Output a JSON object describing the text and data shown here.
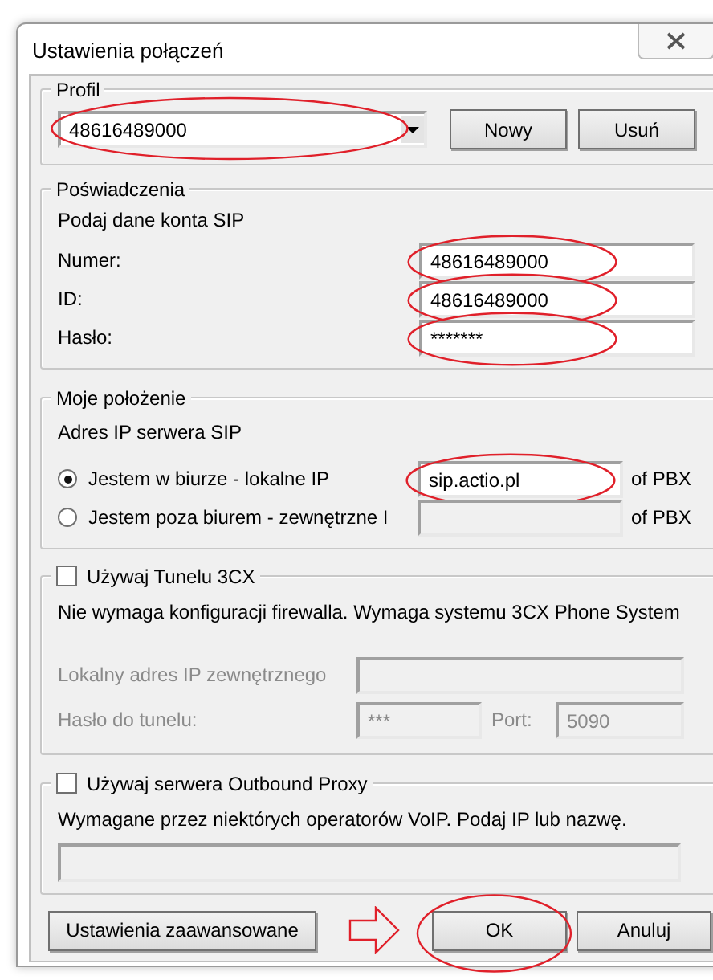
{
  "window": {
    "title": "Ustawienia połączeń"
  },
  "profile": {
    "legend": "Profil",
    "value": "48616489000",
    "marked": true,
    "buttons": [
      {
        "label": "Nowy"
      },
      {
        "label": "Usuń"
      }
    ]
  },
  "credentials": {
    "legend": "Poświadczenia",
    "hint": "Podaj dane konta SIP",
    "fields": [
      {
        "label": "Numer:",
        "value": "48616489000",
        "marked": true
      },
      {
        "label": "ID:",
        "value": "48616489000",
        "marked": true
      },
      {
        "label": "Hasło:",
        "value": "*******",
        "marked": true
      }
    ]
  },
  "location": {
    "legend": "Moje położenie",
    "hint": "Adres IP serwera SIP",
    "options": [
      {
        "label": "Jestem w biurze - lokalne IP",
        "selected": true,
        "value": "sip.actio.pl",
        "marked": true,
        "disabled": false,
        "suffix": "of PBX"
      },
      {
        "label": "Jestem poza biurem - zewnętrzne I",
        "selected": false,
        "marked": false,
        "disabled": true,
        "suffix": "of PBX"
      }
    ]
  },
  "tunnel": {
    "label": "Używaj Tunelu 3CX",
    "checked": false,
    "disabled": true,
    "note": "Nie wymaga konfiguracji firewalla. Wymaga systemu 3CX Phone System",
    "address_label": "Lokalny adres IP zewnętrznego",
    "password_label": "Hasło do tunelu:",
    "password": "***",
    "port_label": "Port:",
    "port": "5090"
  },
  "proxy": {
    "label": "Używaj serwera Outbound Proxy",
    "checked": false,
    "note": "Wymagane przez niektórych operatorów VoIP. Podaj IP lub nazwę."
  },
  "buttons": [
    {
      "label": "Ustawienia zaawansowane",
      "marked": false,
      "arrow": false
    },
    {
      "label": "OK",
      "marked": true,
      "arrow": true
    },
    {
      "label": "Anuluj",
      "marked": false,
      "arrow": false
    }
  ]
}
